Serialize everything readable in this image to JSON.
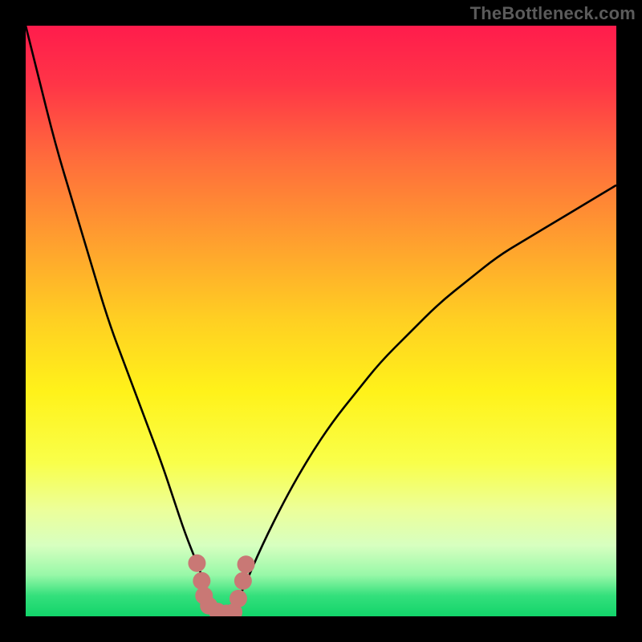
{
  "watermark": "TheBottleneck.com",
  "chart_data": {
    "type": "line",
    "title": "",
    "xlabel": "",
    "ylabel": "",
    "xlim": [
      0,
      100
    ],
    "ylim": [
      0,
      100
    ],
    "grid": false,
    "legend": false,
    "series": [
      {
        "name": "curve",
        "x": [
          0,
          2,
          5,
          8,
          11,
          14,
          17,
          20,
          23,
          25,
          27,
          29,
          30.5,
          31.8,
          33,
          34,
          35,
          37,
          40,
          44,
          48,
          52,
          56,
          60,
          65,
          70,
          75,
          80,
          85,
          90,
          95,
          100
        ],
        "y": [
          100,
          92,
          80,
          70,
          60,
          50,
          42,
          34,
          26,
          20,
          14,
          9,
          5,
          2,
          0.5,
          0,
          1,
          5,
          12,
          20,
          27,
          33,
          38,
          43,
          48,
          53,
          57,
          61,
          64,
          67,
          70,
          73
        ]
      }
    ],
    "markers": [
      {
        "x": 29.0,
        "y": 9.0
      },
      {
        "x": 29.8,
        "y": 6.0
      },
      {
        "x": 30.2,
        "y": 3.5
      },
      {
        "x": 31.0,
        "y": 1.8
      },
      {
        "x": 32.5,
        "y": 0.8
      },
      {
        "x": 34.0,
        "y": 0.5
      },
      {
        "x": 35.2,
        "y": 0.7
      },
      {
        "x": 36.0,
        "y": 3.0
      },
      {
        "x": 36.8,
        "y": 6.0
      },
      {
        "x": 37.3,
        "y": 8.8
      }
    ],
    "gradient_stops": [
      {
        "offset": 0.0,
        "color": "#ff1c4c"
      },
      {
        "offset": 0.1,
        "color": "#ff3547"
      },
      {
        "offset": 0.22,
        "color": "#ff6a3c"
      },
      {
        "offset": 0.35,
        "color": "#ff9a30"
      },
      {
        "offset": 0.5,
        "color": "#ffd022"
      },
      {
        "offset": 0.62,
        "color": "#fff21a"
      },
      {
        "offset": 0.74,
        "color": "#f9ff4a"
      },
      {
        "offset": 0.82,
        "color": "#ecff9a"
      },
      {
        "offset": 0.88,
        "color": "#d7ffc0"
      },
      {
        "offset": 0.93,
        "color": "#98f8a8"
      },
      {
        "offset": 0.965,
        "color": "#34e07c"
      },
      {
        "offset": 1.0,
        "color": "#12d46a"
      }
    ],
    "curve_color": "#000000",
    "marker_color": "#c97875",
    "marker_radius": 11
  }
}
